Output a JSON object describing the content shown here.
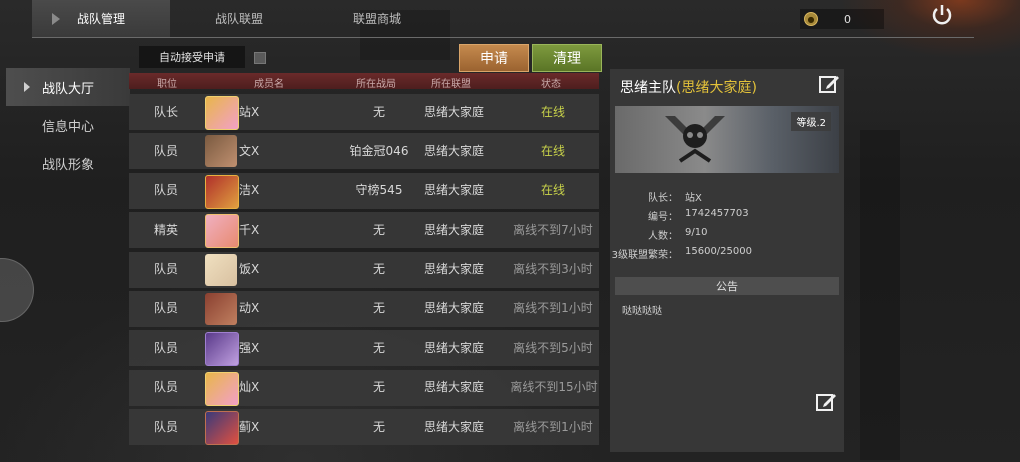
{
  "top_tabs": [
    {
      "label": "战队管理",
      "active": true
    },
    {
      "label": "战队联盟",
      "active": false
    },
    {
      "label": "联盟商城",
      "active": false
    }
  ],
  "currency": {
    "value": "0",
    "icon": "coin-icon"
  },
  "left_nav": [
    {
      "label": "战队大厅",
      "active": true
    },
    {
      "label": "信息中心",
      "active": false
    },
    {
      "label": "战队形象",
      "active": false
    }
  ],
  "auto_accept_label": "自动接受申请",
  "buttons": {
    "apply": "申请",
    "clean": "清理"
  },
  "table": {
    "headers": [
      "职位",
      "成员名",
      "所在战局",
      "所在联盟",
      "状态"
    ],
    "rows": [
      {
        "position": "队长",
        "name": "站X",
        "game": "无",
        "alliance": "思绪大家庭",
        "status": "在线",
        "online": true
      },
      {
        "position": "队员",
        "name": "文X",
        "game": "铂金冠046",
        "alliance": "思绪大家庭",
        "status": "在线",
        "online": true
      },
      {
        "position": "队员",
        "name": "洁X",
        "game": "守榜545",
        "alliance": "思绪大家庭",
        "status": "在线",
        "online": true
      },
      {
        "position": "精英",
        "name": "千X",
        "game": "无",
        "alliance": "思绪大家庭",
        "status": "离线不到7小时",
        "online": false
      },
      {
        "position": "队员",
        "name": "饭X",
        "game": "无",
        "alliance": "思绪大家庭",
        "status": "离线不到3小时",
        "online": false
      },
      {
        "position": "队员",
        "name": "动X",
        "game": "无",
        "alliance": "思绪大家庭",
        "status": "离线不到1小时",
        "online": false
      },
      {
        "position": "队员",
        "name": "强X",
        "game": "无",
        "alliance": "思绪大家庭",
        "status": "离线不到5小时",
        "online": false
      },
      {
        "position": "队员",
        "name": "灿X",
        "game": "无",
        "alliance": "思绪大家庭",
        "status": "离线不到15小时",
        "online": false
      },
      {
        "position": "队员",
        "name": "蓟X",
        "game": "无",
        "alliance": "思绪大家庭",
        "status": "离线不到1小时",
        "online": false
      }
    ]
  },
  "team_panel": {
    "title_main": "思绪主队",
    "title_alliance": "(思绪大家庭)",
    "level": "等级.2",
    "info": [
      {
        "key": "队长：",
        "value": "站X"
      },
      {
        "key": "编号：",
        "value": "1742457703"
      },
      {
        "key": "人数：",
        "value": "9/10"
      },
      {
        "key": "3级联盟繁荣：",
        "value": "15600/25000"
      }
    ],
    "notice_label": "公告",
    "notice_text": "哒哒哒哒"
  },
  "colors": {
    "online": "#c8d24a",
    "offline": "#9a9a9a",
    "alliance_title": "#e3c23a",
    "apply_button": "#b07840",
    "clean_button": "#6c8832"
  }
}
